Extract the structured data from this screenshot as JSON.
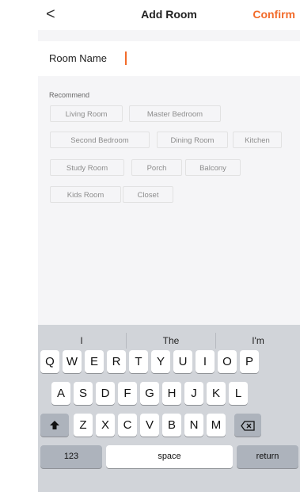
{
  "header": {
    "back_icon": "chevron-left-icon",
    "back_glyph": "<",
    "title": "Add Room",
    "confirm_label": "Confirm"
  },
  "room_name": {
    "label": "Room Name",
    "value": ""
  },
  "recommend": {
    "title": "Recommend",
    "chips": [
      {
        "label": "Living Room"
      },
      {
        "label": "Master Bedroom"
      },
      {
        "label": "Second Bedroom"
      },
      {
        "label": "Dining Room"
      },
      {
        "label": "Kitchen"
      },
      {
        "label": "Study Room"
      },
      {
        "label": "Porch"
      },
      {
        "label": "Balcony"
      },
      {
        "label": "Kids Room"
      },
      {
        "label": "Closet"
      }
    ]
  },
  "keyboard": {
    "suggestions": [
      "I",
      "The",
      "I'm"
    ],
    "row1": [
      "Q",
      "W",
      "E",
      "R",
      "T",
      "Y",
      "U",
      "I",
      "O",
      "P"
    ],
    "row2": [
      "A",
      "S",
      "D",
      "F",
      "G",
      "H",
      "J",
      "K",
      "L"
    ],
    "row3": [
      "Z",
      "X",
      "C",
      "V",
      "B",
      "N",
      "M"
    ],
    "numbers_label": "123",
    "space_label": "space",
    "return_label": "return",
    "shift_icon": "shift-icon",
    "backspace_icon": "backspace-icon"
  },
  "colors": {
    "accent": "#f26b2a",
    "keyboard_bg": "#d1d4d9"
  }
}
